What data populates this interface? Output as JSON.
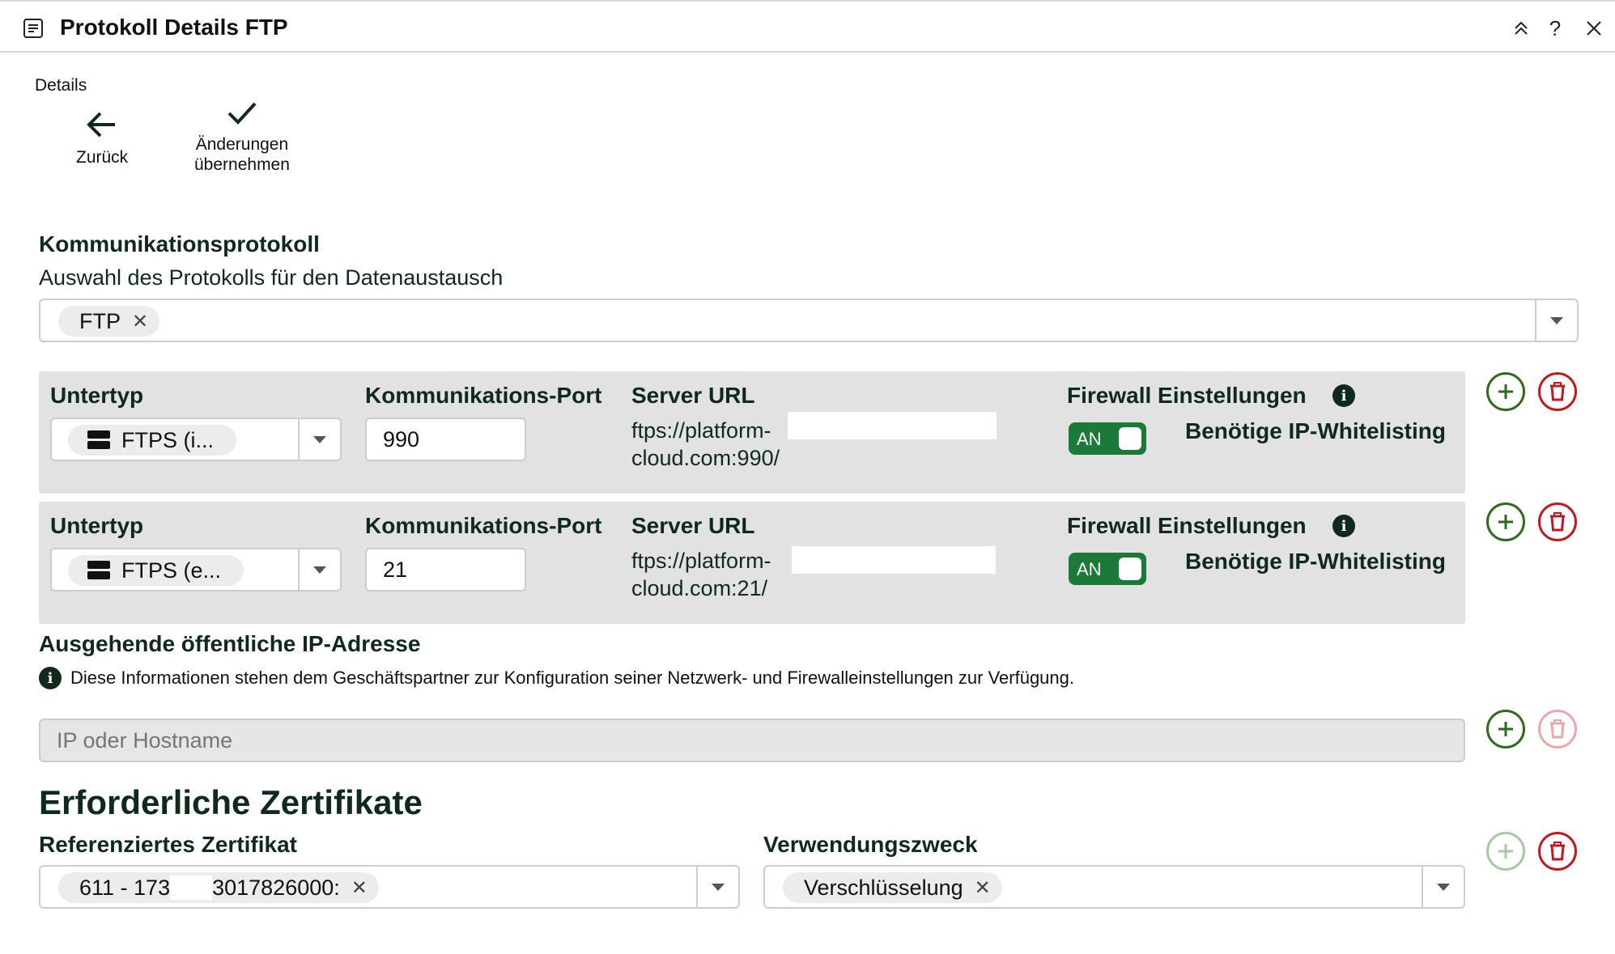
{
  "window": {
    "title": "Protokoll Details FTP",
    "collapse_icon": "double-chevron-up-icon",
    "help_label": "?",
    "close_icon": "close-icon"
  },
  "toolbar": {
    "label": "Details",
    "back_label": "Zurück",
    "apply_line1": "Änderungen",
    "apply_line2": "übernehmen"
  },
  "protocol": {
    "heading": "Kommunikationsprotokoll",
    "description": "Auswahl des Protokolls für den Datenaustausch",
    "selected": "FTP"
  },
  "rows": [
    {
      "subtype_title": "Untertyp",
      "subtype_value": "FTPS (i...",
      "port_title": "Kommunikations-Port",
      "port_value": "990",
      "url_title": "Server URL",
      "url_line1": "ftps://platform-",
      "url_line2": "cloud.com:990/",
      "firewall_title": "Firewall Einstellungen",
      "toggle_label": "AN",
      "whitelist_label": "Benötige IP-Whitelisting"
    },
    {
      "subtype_title": "Untertyp",
      "subtype_value": "FTPS (e...",
      "port_title": "Kommunikations-Port",
      "port_value": "21",
      "url_title": "Server URL",
      "url_line1": "ftps://platform-",
      "url_line2": "cloud.com:21/",
      "firewall_title": "Firewall Einstellungen",
      "toggle_label": "AN",
      "whitelist_label": "Benötige IP-Whitelisting"
    }
  ],
  "outgoing_ip": {
    "heading": "Ausgehende öffentliche IP-Adresse",
    "info": "Diese Informationen stehen dem Geschäftspartner zur Konfiguration seiner Netzwerk- und Firewalleinstellungen zur Verfügung.",
    "placeholder": "IP oder Hostname"
  },
  "certificates": {
    "heading": "Erforderliche Zertifikate",
    "ref_label": "Referenziertes Zertifikat",
    "ref_value_a": "611 - 173",
    "ref_value_b": "3017826000:",
    "purpose_label": "Verwendungszweck",
    "purpose_value": "Verschlüsselung"
  },
  "colors": {
    "accent_green": "#1b7a3a",
    "add_green": "#2f6b1e",
    "delete_red": "#c0191f",
    "panel_gray": "#e2e2e2",
    "text_dark": "#0f2a1c"
  }
}
